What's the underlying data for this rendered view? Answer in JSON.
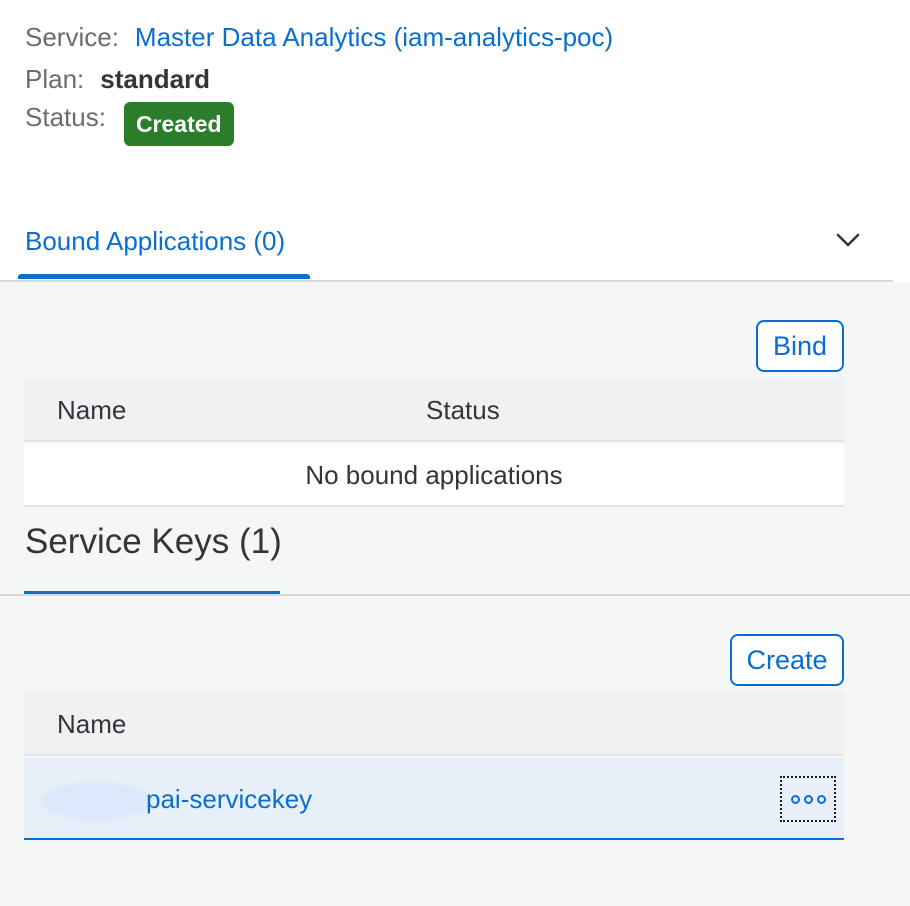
{
  "service": {
    "label": "Service:",
    "value": "Master Data Analytics (iam-analytics-poc)"
  },
  "plan": {
    "label": "Plan:",
    "value": "standard"
  },
  "status": {
    "label": "Status:",
    "value": "Created",
    "color": "#2b7d2b"
  },
  "tabs": {
    "bound_applications": "Bound Applications (0)"
  },
  "bound_applications": {
    "bind_label": "Bind",
    "columns": [
      "Name",
      "Status"
    ],
    "empty_text": "No bound applications"
  },
  "service_keys": {
    "title": "Service Keys (1)",
    "create_label": "Create",
    "columns": [
      "Name"
    ],
    "rows": [
      {
        "name": "pai-servicekey"
      }
    ]
  },
  "icons": {
    "collapse": "chevron-down-icon",
    "more": "more-options-icon"
  },
  "colors": {
    "accent": "#0a6ed1",
    "status_success": "#2b7d2b",
    "panel_background": "#f5f6f6"
  }
}
